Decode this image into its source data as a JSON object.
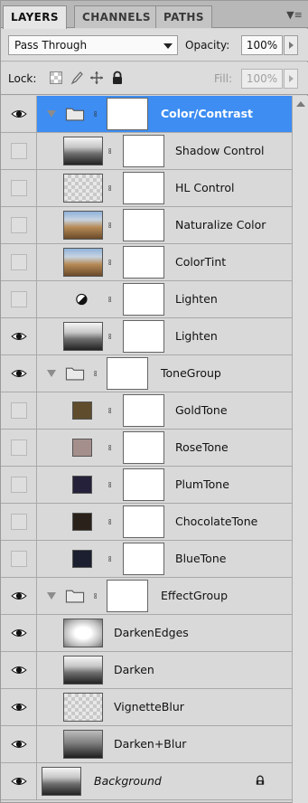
{
  "tabs": [
    "LAYERS",
    "CHANNELS",
    "PATHS"
  ],
  "panel_menu_icon": "panel-menu-icon",
  "blend": {
    "mode": "Pass Through",
    "opacity_label": "Opacity:",
    "opacity_value": "100%"
  },
  "lock": {
    "label": "Lock:",
    "fill_label": "Fill:",
    "fill_value": "100%",
    "icons": [
      "lock-transparent-icon",
      "lock-image-icon",
      "lock-position-icon",
      "lock-all-icon"
    ]
  },
  "colors": {
    "selected": "#3d8df2",
    "panel": "#d9d9d9"
  },
  "layers": [
    {
      "name": "Color/Contrast",
      "kind": "group",
      "visible": true,
      "selected": true,
      "indent": 0
    },
    {
      "name": "Shadow Control",
      "kind": "adjustment",
      "thumb": "photo-checker",
      "visible": false,
      "indent": 1
    },
    {
      "name": "HL Control",
      "kind": "adjustment",
      "thumb": "checker",
      "visible": false,
      "indent": 1
    },
    {
      "name": "Naturalize Color",
      "kind": "adjustment",
      "thumb": "photo-color",
      "visible": false,
      "indent": 1
    },
    {
      "name": "ColorTint",
      "kind": "adjustment",
      "thumb": "photo-color",
      "visible": false,
      "indent": 1
    },
    {
      "name": "Lighten",
      "kind": "adjustment",
      "thumb": "contrast-icon",
      "visible": false,
      "indent": 1
    },
    {
      "name": "Lighten",
      "kind": "adjustment",
      "thumb": "photo-bw",
      "visible": true,
      "indent": 1
    },
    {
      "name": "ToneGroup",
      "kind": "group",
      "visible": true,
      "indent": 0
    },
    {
      "name": "GoldTone",
      "kind": "fill",
      "color": "#5f4c2d",
      "visible": false,
      "indent": 1
    },
    {
      "name": "RoseTone",
      "kind": "fill",
      "color": "#a58f8c",
      "visible": false,
      "indent": 1
    },
    {
      "name": "PlumTone",
      "kind": "fill",
      "color": "#26213a",
      "visible": false,
      "indent": 1
    },
    {
      "name": "ChocolateTone",
      "kind": "fill",
      "color": "#2a211a",
      "visible": false,
      "indent": 1
    },
    {
      "name": "BlueTone",
      "kind": "fill",
      "color": "#1b1f2f",
      "visible": false,
      "indent": 1
    },
    {
      "name": "EffectGroup",
      "kind": "group",
      "visible": true,
      "indent": 0
    },
    {
      "name": "DarkenEdges",
      "kind": "pixel",
      "thumb": "vignette",
      "visible": true,
      "indent": 1
    },
    {
      "name": "Darken",
      "kind": "pixel",
      "thumb": "photo-bw",
      "visible": true,
      "indent": 1
    },
    {
      "name": "VignetteBlur",
      "kind": "pixel",
      "thumb": "checker",
      "visible": true,
      "indent": 1
    },
    {
      "name": "Darken+Blur",
      "kind": "pixel",
      "thumb": "photo-dark",
      "visible": true,
      "indent": 1
    },
    {
      "name": "Background",
      "kind": "background",
      "thumb": "photo-bw",
      "visible": true,
      "locked": true,
      "indent": 0
    }
  ]
}
